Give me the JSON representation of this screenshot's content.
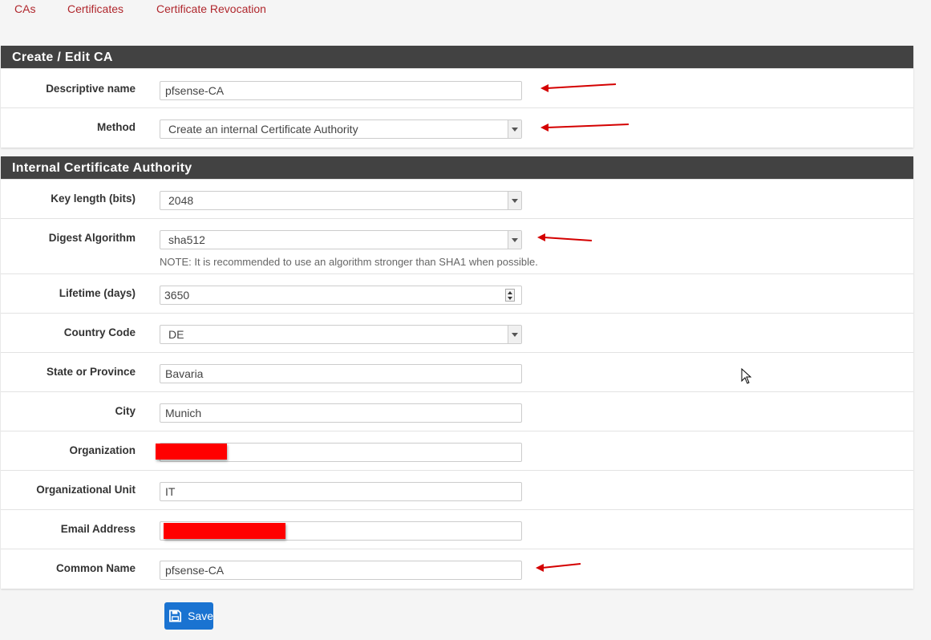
{
  "tabs": [
    {
      "label": "CAs",
      "active": true
    },
    {
      "label": "Certificates",
      "active": false
    },
    {
      "label": "Certificate Revocation",
      "active": false
    }
  ],
  "colors": {
    "accent": "#b0272d",
    "panel_heading": "#424242",
    "button": "#1a73d1",
    "redaction": "#ff0000",
    "arrow": "#d40000"
  },
  "panel_create": {
    "title": "Create / Edit CA",
    "descriptive_name": {
      "label": "Descriptive name",
      "value": "pfsense-CA"
    },
    "method": {
      "label": "Method",
      "value": "Create an internal Certificate Authority"
    }
  },
  "panel_internal": {
    "title": "Internal Certificate Authority",
    "key_length": {
      "label": "Key length (bits)",
      "value": "2048"
    },
    "digest": {
      "label": "Digest Algorithm",
      "value": "sha512",
      "note": "NOTE: It is recommended to use an algorithm stronger than SHA1 when possible."
    },
    "lifetime": {
      "label": "Lifetime (days)",
      "value": "3650"
    },
    "country": {
      "label": "Country Code",
      "value": "DE"
    },
    "state": {
      "label": "State or Province",
      "value": "Bavaria"
    },
    "city": {
      "label": "City",
      "value": "Munich"
    },
    "organization": {
      "label": "Organization",
      "value": ""
    },
    "org_unit": {
      "label": "Organizational Unit",
      "value": "IT"
    },
    "email": {
      "label": "Email Address",
      "value": ""
    },
    "common_name": {
      "label": "Common Name",
      "value": "pfsense-CA"
    }
  },
  "save_button": {
    "label": "Save",
    "icon": "floppy-disk-icon"
  }
}
